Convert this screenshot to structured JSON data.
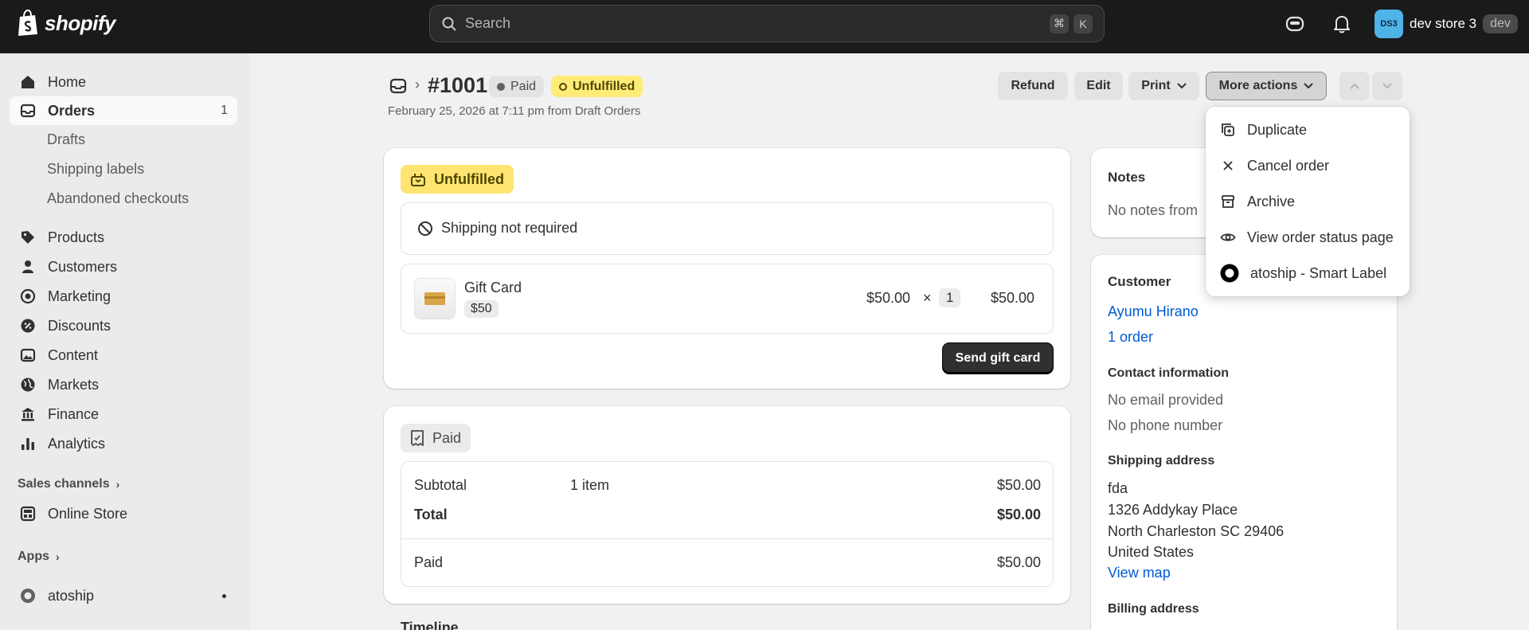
{
  "topbar": {
    "brand": "shopify",
    "search_placeholder": "Search",
    "shortcut_cmd": "⌘",
    "shortcut_key": "K",
    "store_initials": "DS3",
    "store_name": "dev store 3",
    "store_tag": "dev"
  },
  "sidebar": {
    "home": "Home",
    "orders": "Orders",
    "orders_count": "1",
    "drafts": "Drafts",
    "shipping_labels": "Shipping labels",
    "abandoned": "Abandoned checkouts",
    "products": "Products",
    "customers": "Customers",
    "marketing": "Marketing",
    "discounts": "Discounts",
    "content": "Content",
    "markets": "Markets",
    "finance": "Finance",
    "analytics": "Analytics",
    "sales_channels": "Sales channels",
    "online_store": "Online Store",
    "apps": "Apps",
    "atoship": "atoship"
  },
  "header": {
    "order_number": "#1001",
    "paid_badge": "Paid",
    "unfulfilled_badge": "Unfulfilled",
    "subtitle": "February 25, 2026 at 7:11 pm from Draft Orders",
    "refund": "Refund",
    "edit": "Edit",
    "print": "Print",
    "more_actions": "More actions"
  },
  "menu": {
    "duplicate": "Duplicate",
    "cancel": "Cancel order",
    "archive": "Archive",
    "view_status": "View order status page",
    "atoship": "atoship - Smart Label"
  },
  "fulfillment": {
    "status": "Unfulfilled",
    "shipping": "Shipping not required",
    "item_name": "Gift Card",
    "item_variant": "$50",
    "unit_price": "$50.00",
    "times": "×",
    "quantity": "1",
    "line_total": "$50.00",
    "send_button": "Send gift card"
  },
  "payment": {
    "status": "Paid",
    "subtotal_label": "Subtotal",
    "subtotal_items": "1 item",
    "subtotal_value": "$50.00",
    "total_label": "Total",
    "total_value": "$50.00",
    "paid_label": "Paid",
    "paid_value": "$50.00",
    "timeline_heading": "Timeline"
  },
  "notes": {
    "title": "Notes",
    "text": "No notes from"
  },
  "customer": {
    "title": "Customer",
    "name": "Ayumu Hirano",
    "orders": "1 order",
    "contact_title": "Contact information",
    "no_email": "No email provided",
    "no_phone": "No phone number",
    "shipping_title": "Shipping address",
    "addr_name": "fda",
    "addr_line1": "1326 Addykay Place",
    "addr_line2": "North Charleston SC 29406",
    "addr_country": "United States",
    "view_map": "View map",
    "billing_title": "Billing address"
  }
}
